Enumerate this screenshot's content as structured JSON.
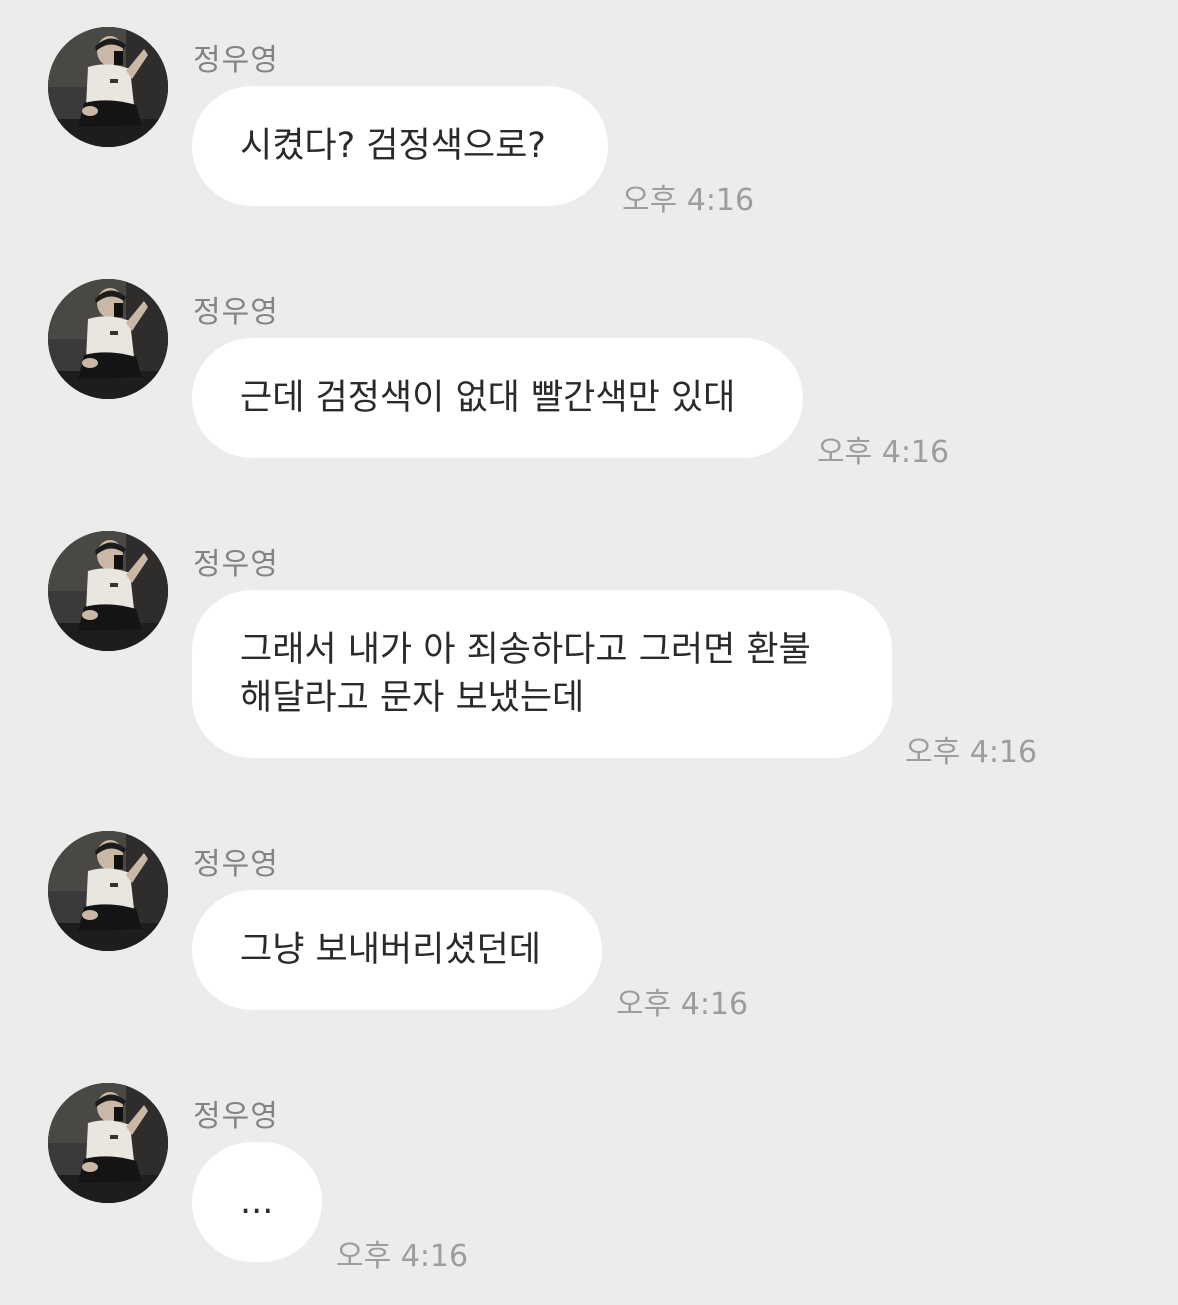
{
  "chat": {
    "messages": [
      {
        "sender": "정우영",
        "lines": [
          "시켰다? 검정색으로?"
        ],
        "time": "오후 4:16",
        "avatar_icon": "profile-photo"
      },
      {
        "sender": "정우영",
        "lines": [
          "근데 검정색이 없대 빨간색만 있대"
        ],
        "time": "오후 4:16",
        "avatar_icon": "profile-photo"
      },
      {
        "sender": "정우영",
        "lines": [
          "그래서 내가 아 죄송하다고 그러면 환불",
          "해달라고 문자 보냈는데"
        ],
        "time": "오후 4:16",
        "avatar_icon": "profile-photo"
      },
      {
        "sender": "정우영",
        "lines": [
          "그냥 보내버리셨던데"
        ],
        "time": "오후 4:16",
        "avatar_icon": "profile-photo"
      },
      {
        "sender": "정우영",
        "lines": [
          "..."
        ],
        "time": "오후 4:16",
        "avatar_icon": "profile-photo"
      }
    ]
  },
  "colors": {
    "background": "#ececec",
    "bubble": "#ffffff",
    "sender_text": "#848484",
    "time_text": "#9d9d9d",
    "message_text": "#2a2a2a"
  }
}
